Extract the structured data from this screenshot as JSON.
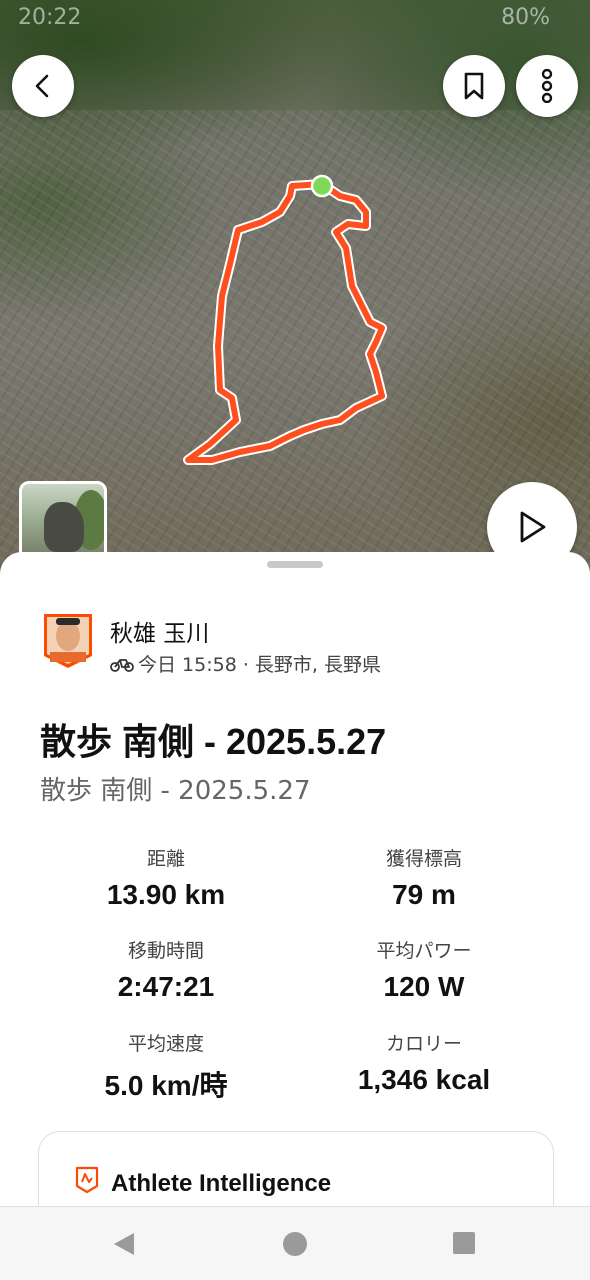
{
  "status_bar": {
    "time": "20:22",
    "battery": "80%"
  },
  "map": {
    "route_color": "#ff4f1f",
    "start_marker_color": "#7ed957"
  },
  "athlete": {
    "name": "秋雄 玉川",
    "meta": "今日 15:58 · 長野市, 長野県",
    "activity_icon": "bike-icon"
  },
  "activity": {
    "title": "散歩 南側 - 2025.5.27",
    "description": "散歩 南側 - 2025.5.27"
  },
  "stats": [
    {
      "label": "距離",
      "value": "13.90 km"
    },
    {
      "label": "獲得標高",
      "value": "79 m"
    },
    {
      "label": "移動時間",
      "value": "2:47:21"
    },
    {
      "label": "平均パワー",
      "value": "120 W"
    },
    {
      "label": "平均速度",
      "value": "5.0 km/時"
    },
    {
      "label": "カロリー",
      "value": "1,346 kcal"
    }
  ],
  "athlete_intelligence": {
    "title": "Athlete Intelligence"
  },
  "colors": {
    "accent": "#fc4c02",
    "text": "#111111",
    "muted": "#666666"
  }
}
